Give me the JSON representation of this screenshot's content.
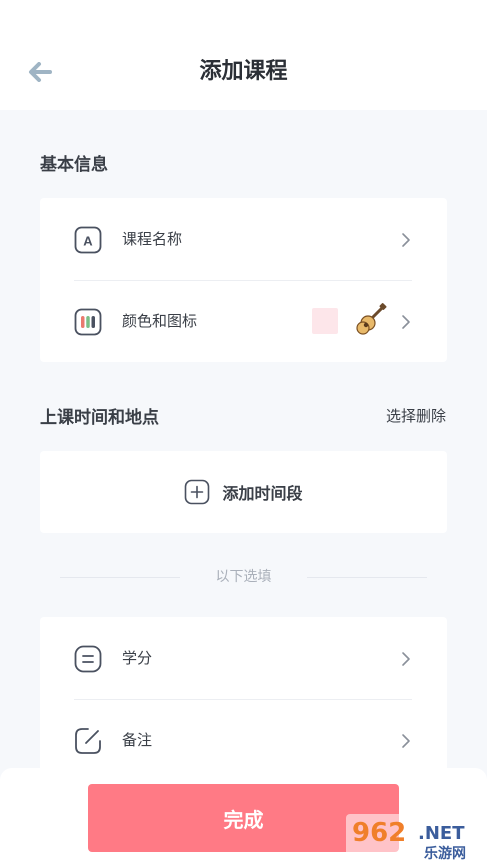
{
  "header": {
    "title": "添加课程",
    "back_icon": "arrow-left-icon"
  },
  "basic_info": {
    "section_title": "基本信息",
    "rows": [
      {
        "label": "课程名称",
        "icon": "letter-a-icon"
      },
      {
        "label": "颜色和图标",
        "icon": "color-dots-icon",
        "swatch_color": "#fde6ea",
        "emoji_icon": "guitar-icon"
      }
    ]
  },
  "schedule": {
    "section_title": "上课时间和地点",
    "action_label": "选择删除",
    "add_label": "添加时间段"
  },
  "optional": {
    "separator_label": "以下选填",
    "rows": [
      {
        "label": "学分",
        "icon": "list-icon"
      },
      {
        "label": "备注",
        "icon": "edit-icon"
      }
    ]
  },
  "footer": {
    "done_label": "完成",
    "accent_color": "#ff7a85"
  },
  "watermark": {
    "brand": "962",
    "suffix": ".NET",
    "caption": "乐游网"
  }
}
